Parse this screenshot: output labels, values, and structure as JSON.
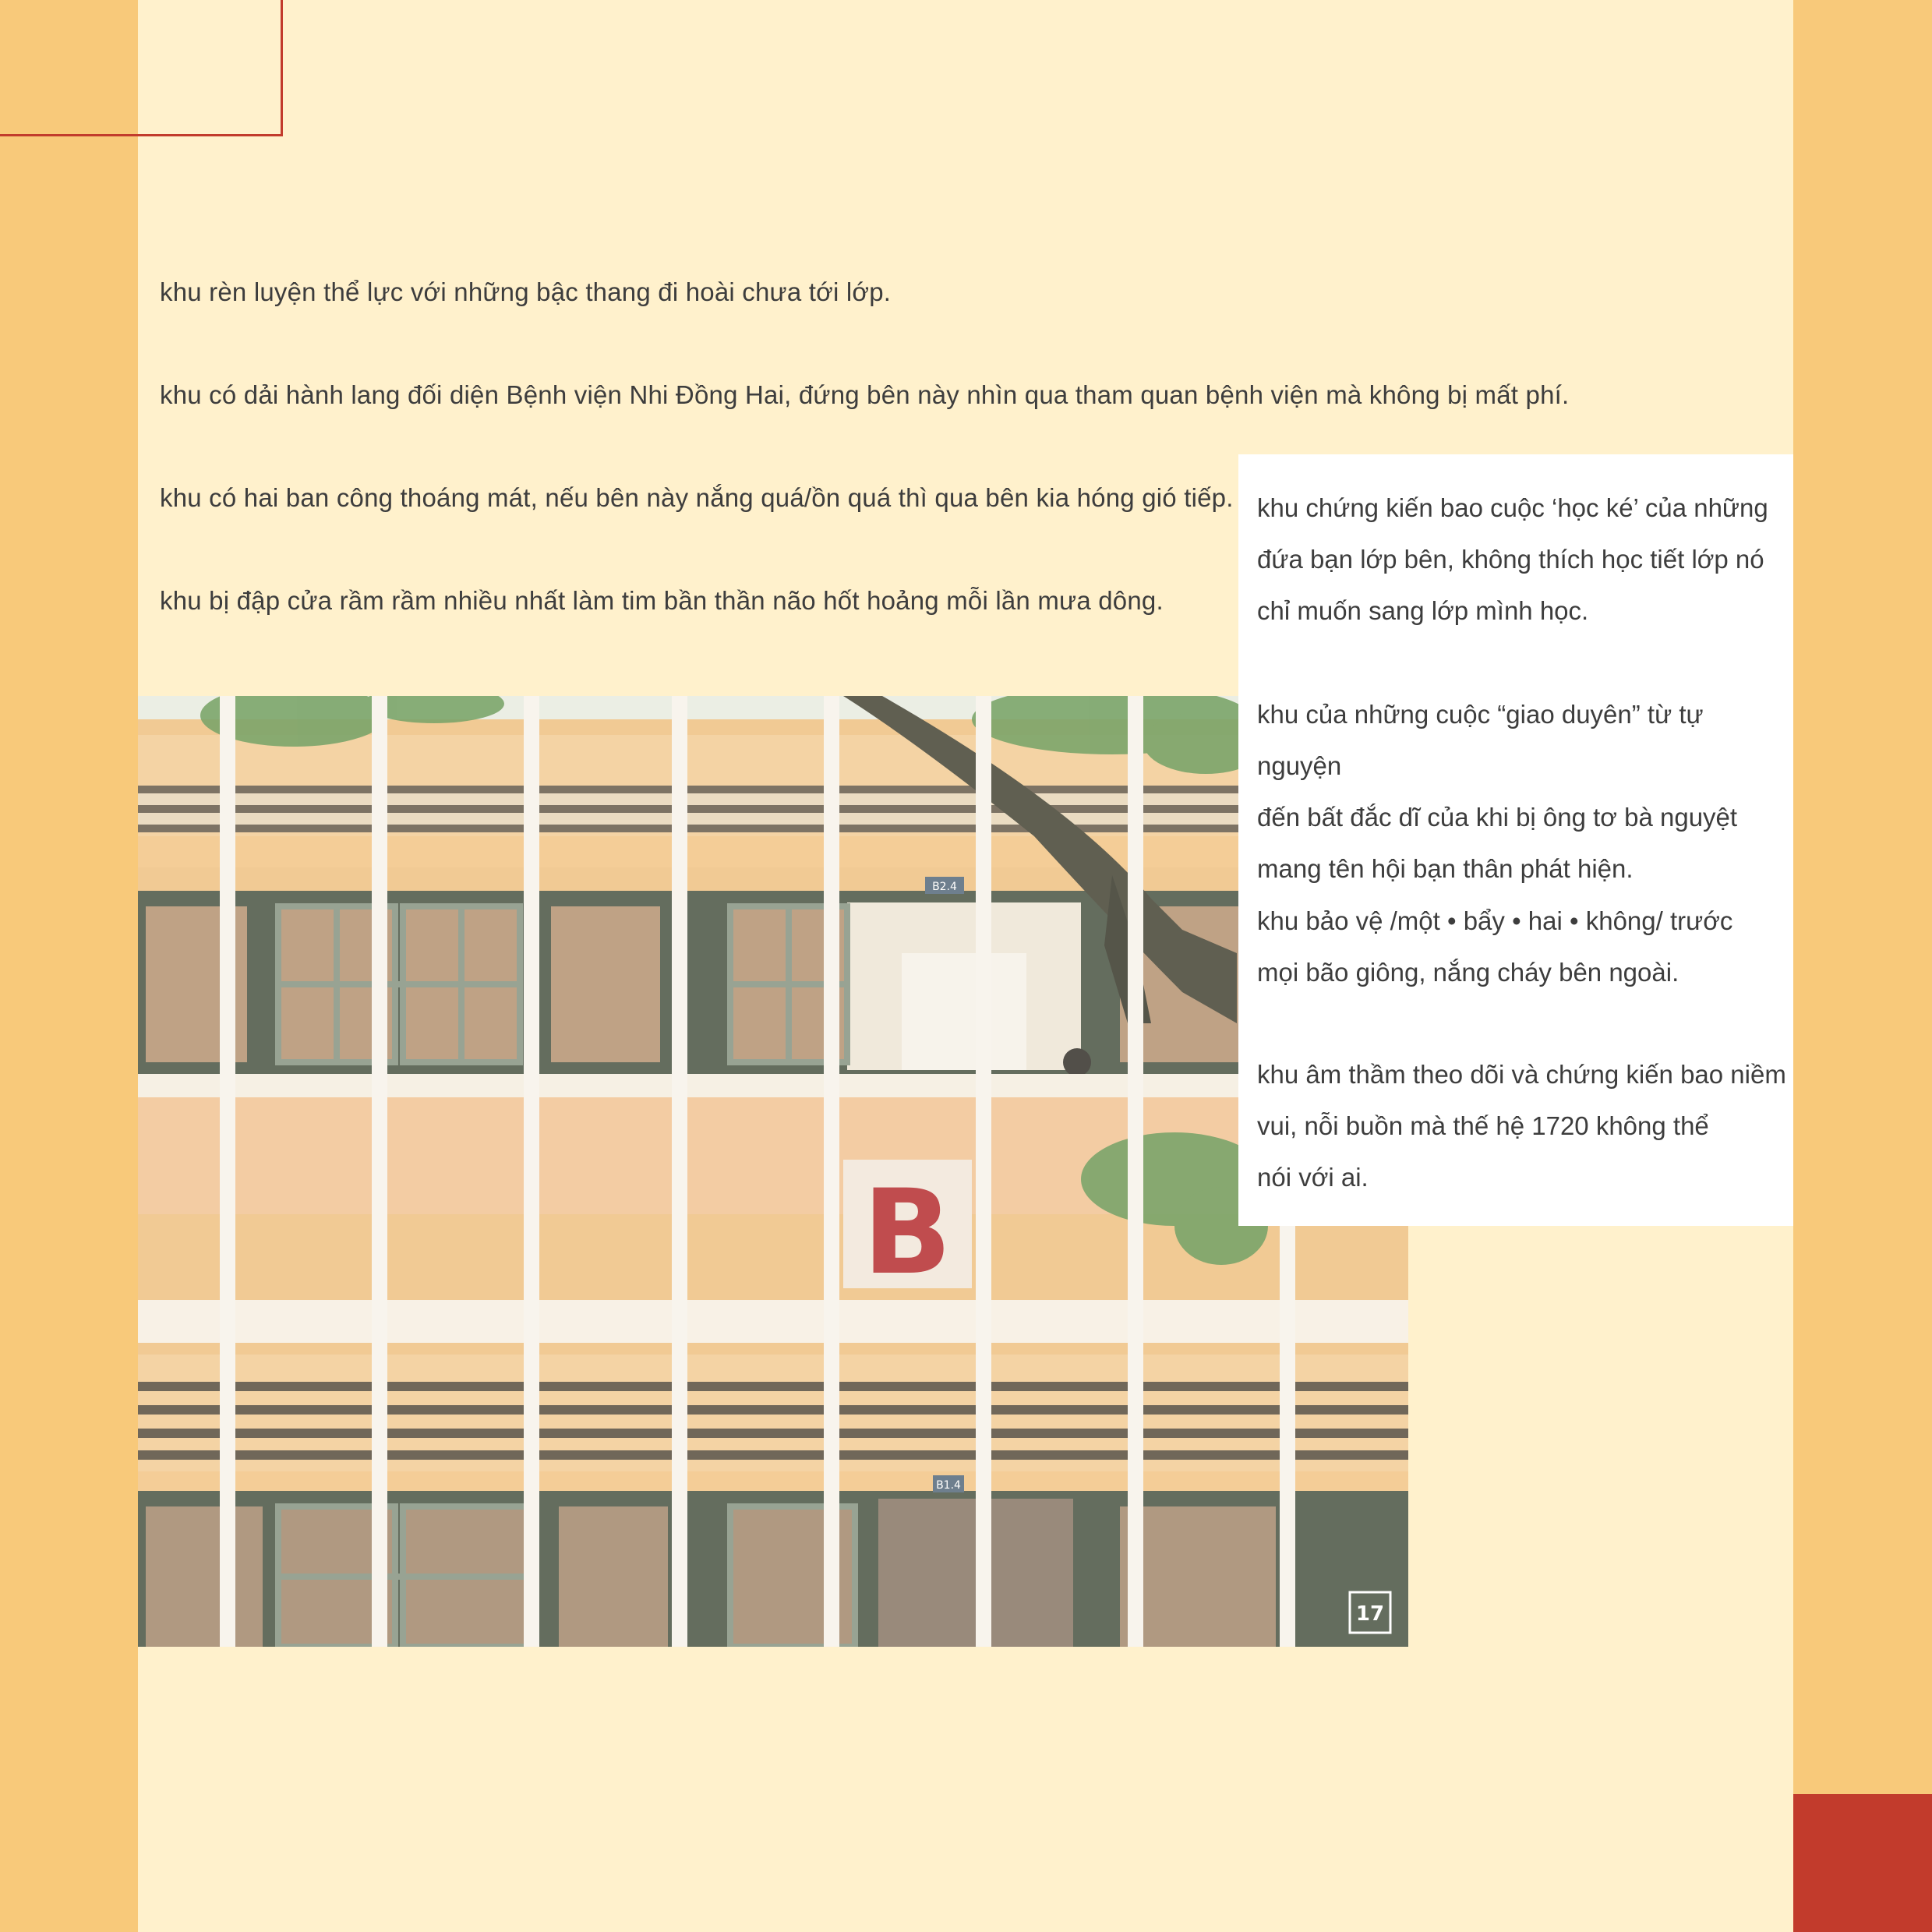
{
  "left_lines": [
    "khu rèn luyện thể lực với những bậc thang đi hoài chưa tới lớp.",
    "khu có dải hành lang đối diện Bệnh viện Nhi Đồng Hai, đứng bên này nhìn qua tham quan bệnh viện mà không bị mất phí.",
    "khu có hai ban công thoáng mát, nếu bên này nắng quá/ồn quá thì qua bên kia hóng gió tiếp.",
    "khu bị đập cửa rầm rầm nhiều nhất làm tim bần thần não hốt hoảng mỗi lần mưa dông."
  ],
  "card_paragraphs": [
    "khu chứng kiến bao cuộc ‘học ké’ của những\nđứa bạn lớp bên, không thích học tiết lớp nó\nchỉ muốn sang lớp mình học.",
    "khu của những cuộc “giao duyên” từ tự nguyện\nđến bất đắc dĩ của khi bị ông tơ bà nguyệt\nmang tên hội bạn thân phát hiện.",
    "khu bảo vệ /một • bẩy • hai • không/ trước\nmọi bão giông, nắng cháy bên ngoài.",
    "khu âm thầm theo dõi và chứng kiến bao niềm\nvui, nỗi buồn mà thế hệ 1720 không thể\nnói với ai."
  ],
  "photo": {
    "big_letter": "B",
    "room_label_upper": "B2.4",
    "room_label_lower": "B1.4",
    "logo_text": "17"
  },
  "colors": {
    "background_orange": "#f8c97a",
    "panel_cream": "#fff1cc",
    "accent_red": "#c23b2c",
    "text": "#3d3d3d"
  }
}
